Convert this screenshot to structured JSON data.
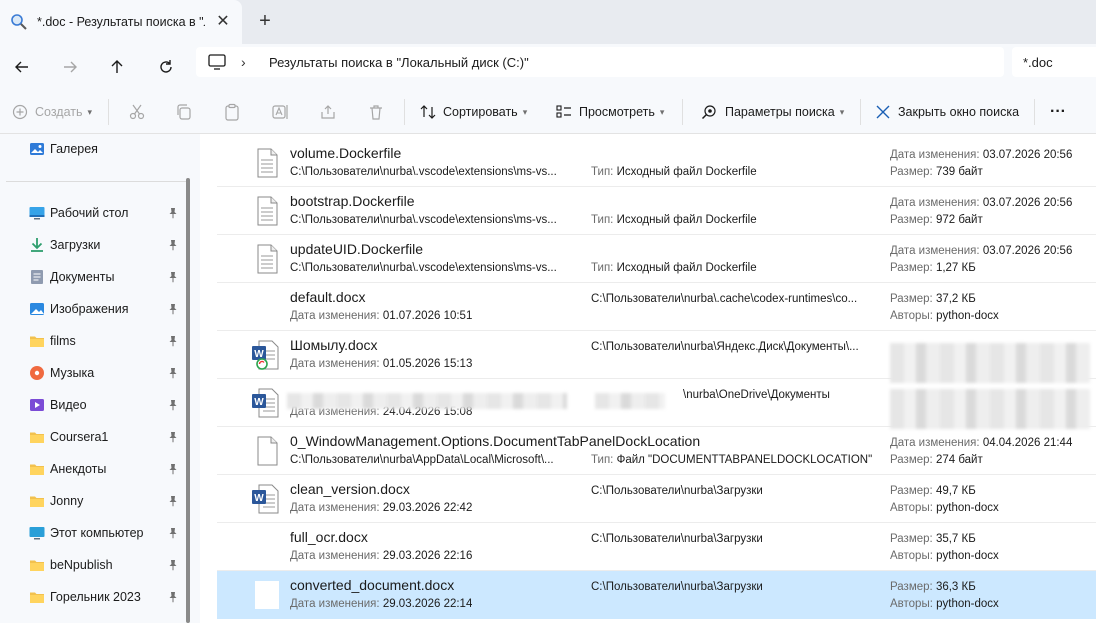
{
  "tab": {
    "title": "*.doc - Результаты поиска в \"Л",
    "close": "✕"
  },
  "newtab": "+",
  "address": {
    "chevron": "›",
    "path": "Результаты поиска в \"Локальный диск (C:)\"",
    "search_value": "*.doc"
  },
  "toolbar": {
    "create": "Создать",
    "sort": "Сортировать",
    "view": "Просмотреть",
    "search_options": "Параметры поиска",
    "close_search": "Закрыть окно поиска",
    "more": "···"
  },
  "sidebar": {
    "items": [
      {
        "label": "Галерея",
        "icon": "gallery-icon"
      },
      {
        "label": "Рабочий стол",
        "icon": "desktop-icon"
      },
      {
        "label": "Загрузки",
        "icon": "downloads-icon"
      },
      {
        "label": "Документы",
        "icon": "documents-icon"
      },
      {
        "label": "Изображения",
        "icon": "pictures-icon"
      },
      {
        "label": "films",
        "icon": "folder-icon"
      },
      {
        "label": "Музыка",
        "icon": "music-icon"
      },
      {
        "label": "Видео",
        "icon": "video-icon"
      },
      {
        "label": "Coursera1",
        "icon": "folder-icon"
      },
      {
        "label": "Анекдоты",
        "icon": "folder-icon"
      },
      {
        "label": "Jonny",
        "icon": "folder-icon"
      },
      {
        "label": "Этот компьютер",
        "icon": "computer-icon"
      },
      {
        "label": "beNpublish",
        "icon": "folder-icon"
      },
      {
        "label": "Горельник 2023",
        "icon": "folder-icon"
      }
    ]
  },
  "labels": {
    "modified": "Дата изменения:",
    "size": "Размер:",
    "type": "Тип:",
    "authors": "Авторы:"
  },
  "files": [
    {
      "name": "volume.Dockerfile",
      "path": "C:\\Пользователи\\nurba\\.vscode\\extensions\\ms-vs...",
      "type": "Исходный файл Dockerfile",
      "modified": "03.07.2026 20:56",
      "size": "739 байт",
      "icon": "generic-file-icon"
    },
    {
      "name": "bootstrap.Dockerfile",
      "path": "C:\\Пользователи\\nurba\\.vscode\\extensions\\ms-vs...",
      "type": "Исходный файл Dockerfile",
      "modified": "03.07.2026 20:56",
      "size": "972 байт",
      "icon": "generic-file-icon"
    },
    {
      "name": "updateUID.Dockerfile",
      "path": "C:\\Пользователи\\nurba\\.vscode\\extensions\\ms-vs...",
      "type": "Исходный файл Dockerfile",
      "modified": "03.07.2026 20:56",
      "size": "1,27 КБ",
      "icon": "generic-file-icon"
    },
    {
      "name": "default.docx",
      "modified": "01.07.2026 10:51",
      "path": "C:\\Пользователи\\nurba\\.cache\\codex-runtimes\\co...",
      "size": "37,2 КБ",
      "authors": "python-docx",
      "icon": "none"
    },
    {
      "name": "Шомылу.docx",
      "modified": "01.05.2026 15:13",
      "path": "C:\\Пользователи\\nurba\\Яндекс.Диск\\Документы\\...",
      "icon": "word-sync-icon"
    },
    {
      "name": "",
      "modified": "24.04.2026 15:08",
      "path": "\\nurba\\OneDrive\\Документы",
      "icon": "word-file-icon"
    },
    {
      "name": "0_WindowManagement.Options.DocumentTabPanelDockLocation",
      "path": "C:\\Пользователи\\nurba\\AppData\\Local\\Microsoft\\...",
      "type": "Файл \"DOCUMENTTABPANELDOCKLOCATION\"",
      "modified": "04.04.2026 21:44",
      "size": "274 байт",
      "icon": "blank-file-icon"
    },
    {
      "name": "clean_version.docx",
      "modified": "29.03.2026 22:42",
      "path": "C:\\Пользователи\\nurba\\Загрузки",
      "size": "49,7 КБ",
      "authors": "python-docx",
      "icon": "word-file-icon"
    },
    {
      "name": "full_ocr.docx",
      "modified": "29.03.2026 22:16",
      "path": "C:\\Пользователи\\nurba\\Загрузки",
      "size": "35,7 КБ",
      "authors": "python-docx",
      "icon": "none"
    },
    {
      "name": "converted_document.docx",
      "modified": "29.03.2026 22:14",
      "path": "C:\\Пользователи\\nurba\\Загрузки",
      "size": "36,3 КБ",
      "authors": "python-docx",
      "icon": "white-file-icon"
    }
  ]
}
